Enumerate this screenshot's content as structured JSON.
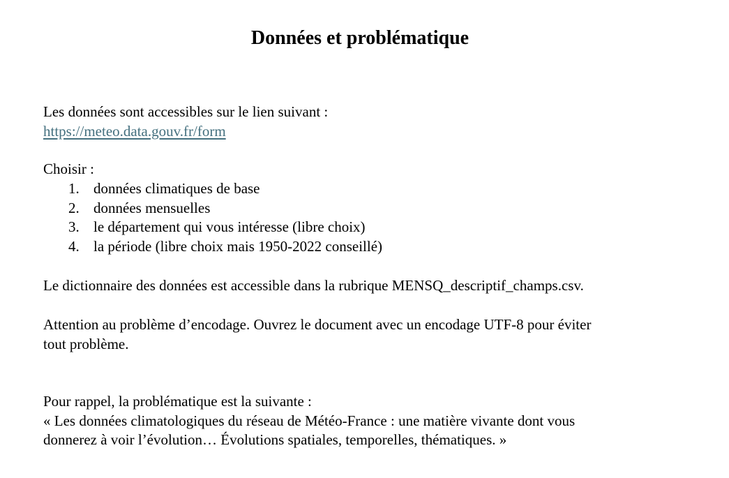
{
  "document": {
    "title": "Données et problématique",
    "intro_line": "Les données sont accessibles sur le lien suivant :",
    "link_text": "https://meteo.data.gouv.fr/form",
    "choose_label": "Choisir :",
    "steps": [
      {
        "number": "1.",
        "text": "données climatiques de base"
      },
      {
        "number": "2.",
        "text": "données mensuelles"
      },
      {
        "number": "3.",
        "text": "le département qui vous intéresse (libre choix)"
      },
      {
        "number": "4.",
        "text": "la période (libre choix mais 1950-2022 conseillé)"
      }
    ],
    "dictionary_line": "Le dictionnaire des données est accessible dans la rubrique MENSQ_descriptif_champs.csv.",
    "encoding_line_1": "Attention au problème d’encodage. Ouvrez le document avec un encodage UTF-8 pour éviter",
    "encoding_line_2": "tout problème.",
    "reminder_line": "Pour rappel, la problématique est la suivante :",
    "quote_line_1": "« Les données climatologiques du réseau de Météo-France : une matière vivante dont vous",
    "quote_line_2": "donnerez à voir l’évolution… Évolutions spatiales, temporelles, thématiques. »"
  },
  "colors": {
    "link": "#44707f",
    "text": "#000000",
    "background": "#ffffff"
  }
}
